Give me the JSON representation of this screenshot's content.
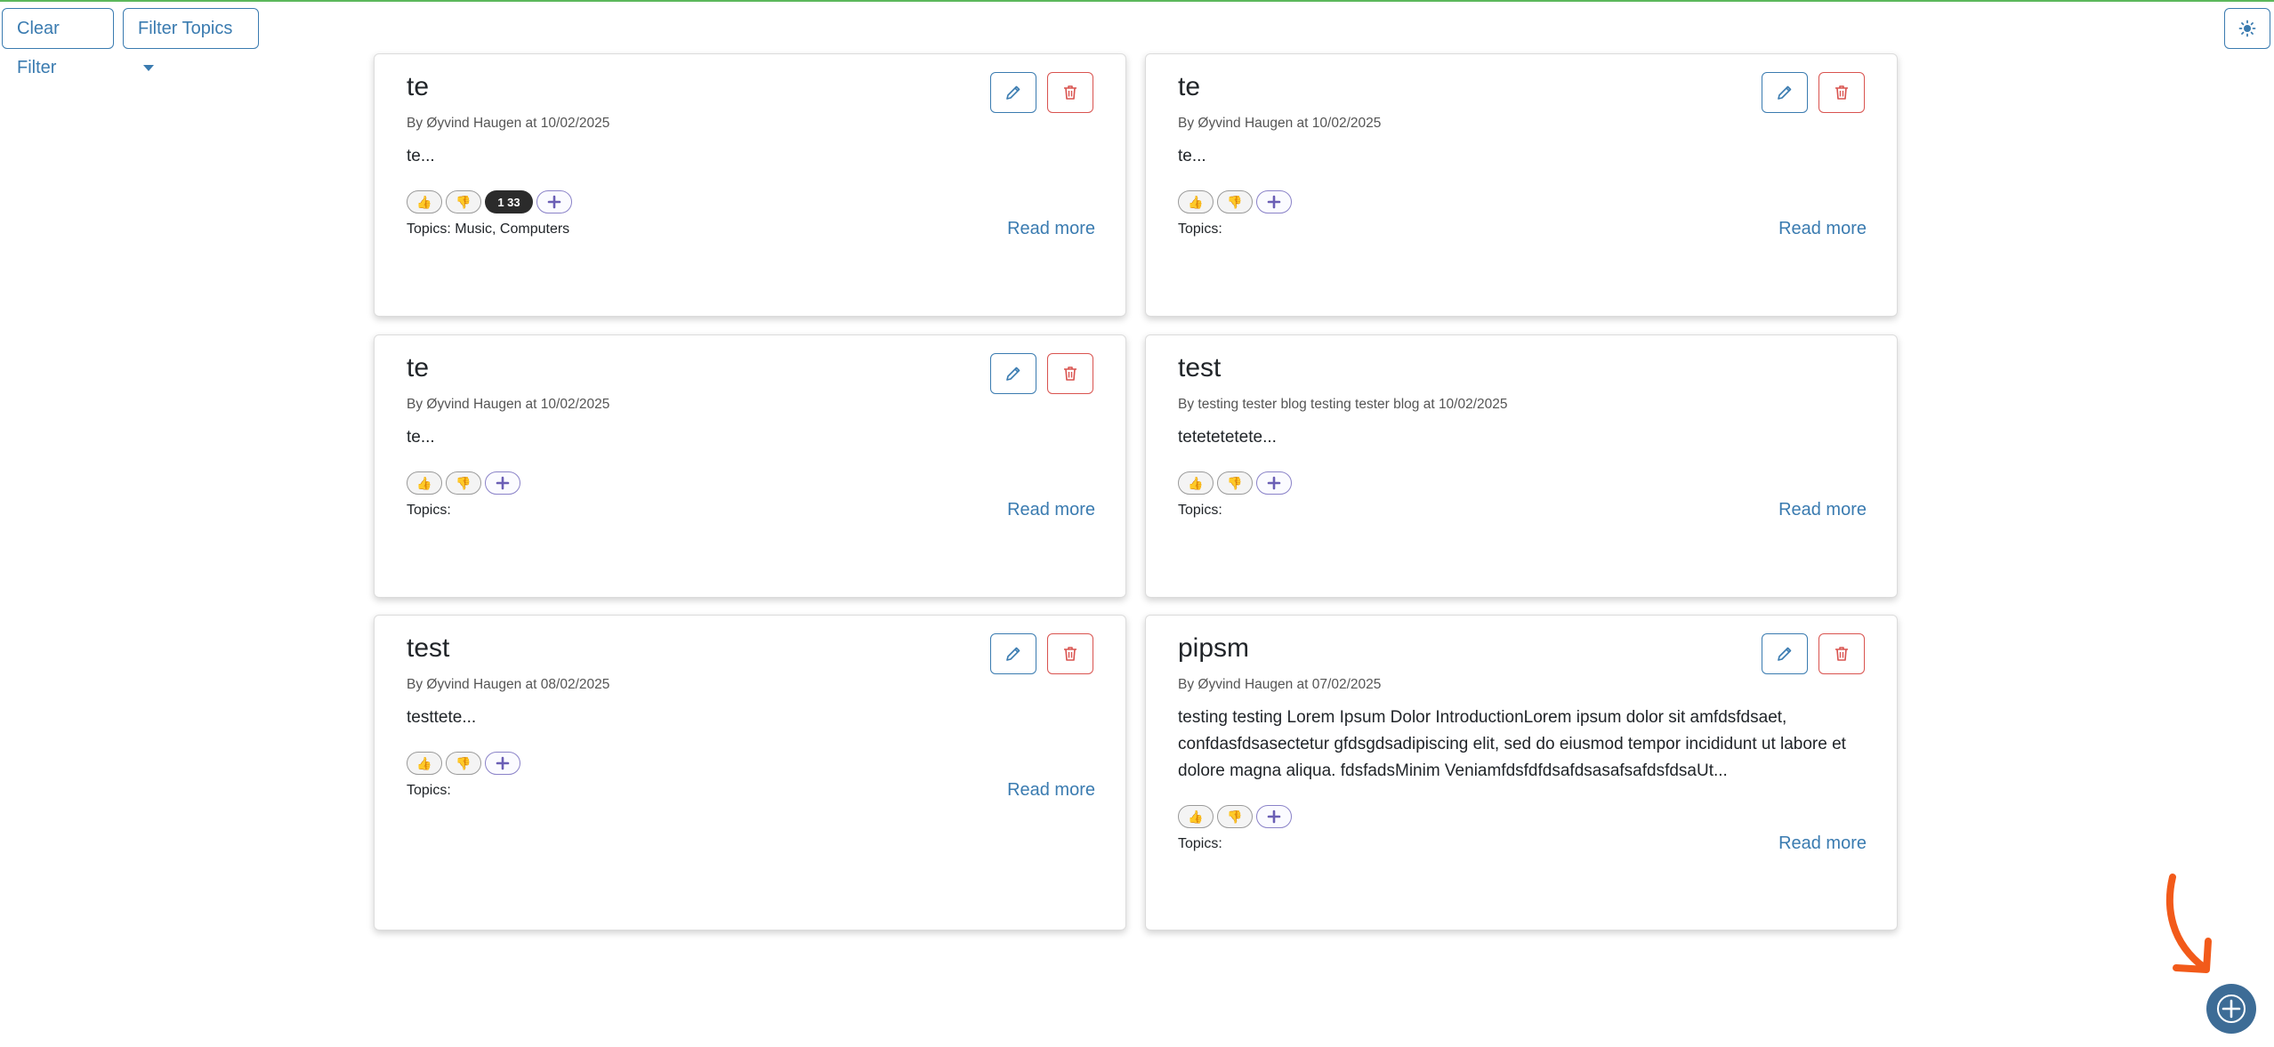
{
  "toolbar": {
    "clear_filter_label": "Clear Filter",
    "filter_topics_label": "Filter Topics",
    "theme_icon": "sun-icon"
  },
  "colors": {
    "primary": "#3a7bb0",
    "danger": "#d9534f",
    "fab": "#3d6c96",
    "annotation_arrow": "#f25a1a"
  },
  "posts": [
    {
      "title": "te",
      "meta": "By Øyvind Haugen at 10/02/2025",
      "body": "te...",
      "reaction_count": "1 33",
      "topics": "Topics: Music, Computers",
      "read_more": "Read more"
    },
    {
      "title": "te",
      "meta": "By Øyvind Haugen at 10/02/2025",
      "body": "te...",
      "topics": "Topics:",
      "read_more": "Read more"
    },
    {
      "title": "te",
      "meta": "By Øyvind Haugen at 10/02/2025",
      "body": "te...",
      "topics": "Topics:",
      "read_more": "Read more"
    },
    {
      "title": "test",
      "meta": "By testing tester blog testing tester blog at 10/02/2025",
      "body": "tetetetetete...",
      "topics": "Topics:",
      "read_more": "Read more"
    },
    {
      "title": "test",
      "meta": "By Øyvind Haugen at 08/02/2025",
      "body": "testtete...",
      "topics": "Topics:",
      "read_more": "Read more"
    },
    {
      "title": "pipsm",
      "meta": "By Øyvind Haugen at 07/02/2025",
      "body": "testing testing Lorem Ipsum Dolor IntroductionLorem ipsum dolor sit amfdsfdsaet, confdasfdsasectetur gfdsgdsadipiscing elit, sed do eiusmod tempor incididunt ut labore et dolore magna aliqua. fdsfadsMinim VeniamfdsfdfdsafdsasafsafdsfdsaUt...",
      "topics": "Topics:",
      "read_more": "Read more"
    }
  ],
  "reactions": {
    "like_emoji": "👍",
    "dislike_emoji": "👎",
    "add_symbol": "+"
  },
  "fab": {
    "icon": "plus-icon"
  }
}
